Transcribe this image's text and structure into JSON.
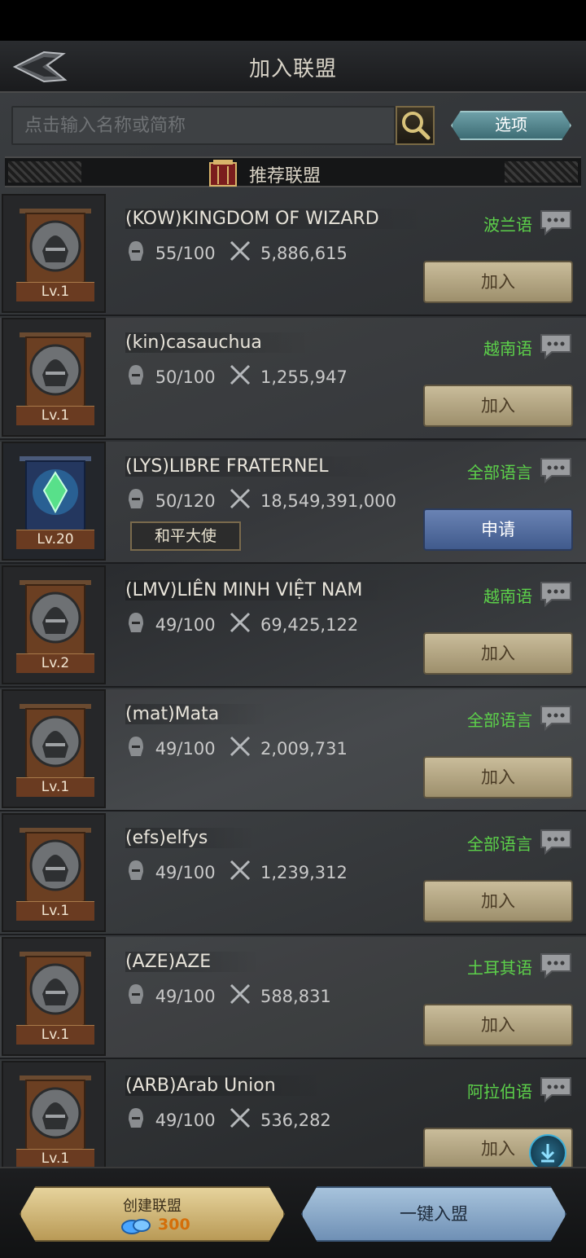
{
  "header": {
    "title": "加入联盟"
  },
  "search": {
    "placeholder": "点击输入名称或简称",
    "options_label": "选项"
  },
  "section": {
    "title": "推荐联盟"
  },
  "alliances": [
    {
      "name": "(KOW)KINGDOM OF WIZARD",
      "members": "55/100",
      "power": "5,886,615",
      "language": "波兰语",
      "level": "Lv.1",
      "action": "加入"
    },
    {
      "name": "(kin)casauchua",
      "members": "50/100",
      "power": "1,255,947",
      "language": "越南语",
      "level": "Lv.1",
      "action": "加入"
    },
    {
      "name": "(LYS)LIBRE FRATERNEL",
      "members": "50/120",
      "power": "18,549,391,000",
      "language": "全部语言",
      "level": "Lv.20",
      "action": "申请",
      "tag": "和平大使"
    },
    {
      "name": "(LMV)LIÊN MINH VIỆT NAM",
      "members": "49/100",
      "power": "69,425,122",
      "language": "越南语",
      "level": "Lv.2",
      "action": "加入"
    },
    {
      "name": "(mat)Mata",
      "members": "49/100",
      "power": "2,009,731",
      "language": "全部语言",
      "level": "Lv.1",
      "action": "加入"
    },
    {
      "name": "(efs)elfys",
      "members": "49/100",
      "power": "1,239,312",
      "language": "全部语言",
      "level": "Lv.1",
      "action": "加入"
    },
    {
      "name": "(AZE)AZE",
      "members": "49/100",
      "power": "588,831",
      "language": "土耳其语",
      "level": "Lv.1",
      "action": "加入"
    },
    {
      "name": "(ARB)Arab Union",
      "members": "49/100",
      "power": "536,282",
      "language": "阿拉伯语",
      "level": "Lv.1",
      "action": "加入"
    }
  ],
  "footer": {
    "create_label": "创建联盟",
    "create_cost": "300",
    "one_key_label": "一键入盟"
  },
  "colors": {
    "language_green": "#5cd14a",
    "join_gold": "#c9bc9a",
    "apply_blue": "#5a74a6"
  },
  "icons": {
    "back": "back-arrow-icon",
    "search": "magnifier-icon",
    "members": "helmet-icon",
    "power": "crossed-swords-icon",
    "chat": "chat-bubble-icon",
    "gem": "gem-icon"
  }
}
